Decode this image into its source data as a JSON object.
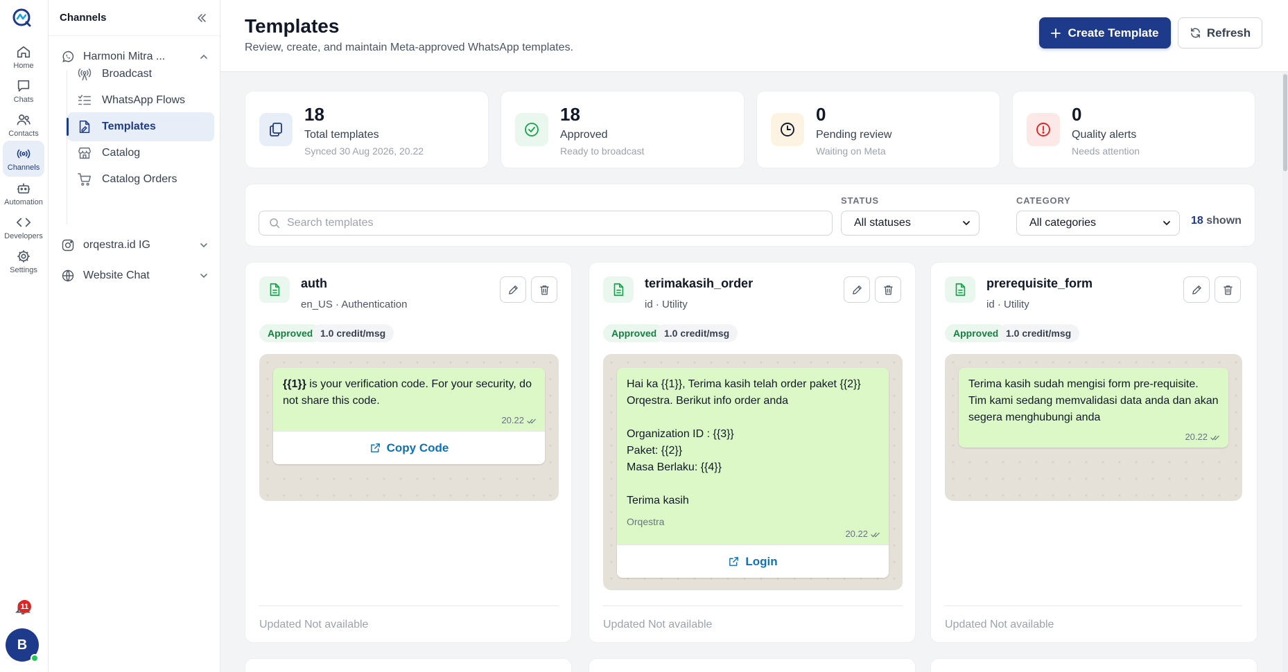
{
  "rail": {
    "items": [
      {
        "label": "Home",
        "icon": "home-icon"
      },
      {
        "label": "Chats",
        "icon": "chat-icon"
      },
      {
        "label": "Contacts",
        "icon": "contacts-icon"
      },
      {
        "label": "Channels",
        "icon": "broadcast-icon"
      },
      {
        "label": "Automation",
        "icon": "robot-icon"
      },
      {
        "label": "Developers",
        "icon": "code-icon"
      },
      {
        "label": "Settings",
        "icon": "gear-icon"
      }
    ],
    "notification_count": "11",
    "avatar_initial": "B"
  },
  "sidebar": {
    "title": "Channels",
    "groups": [
      {
        "label": "Harmoni Mitra ...",
        "icon": "whatsapp-icon"
      },
      {
        "label": "orqestra.id IG",
        "icon": "instagram-icon"
      },
      {
        "label": "Website Chat",
        "icon": "globe-icon"
      }
    ],
    "items": [
      {
        "label": "Broadcast",
        "icon": "broadcast-icon"
      },
      {
        "label": "WhatsApp Flows",
        "icon": "list-check-icon"
      },
      {
        "label": "Templates",
        "icon": "file-signature-icon"
      },
      {
        "label": "Catalog",
        "icon": "store-icon"
      },
      {
        "label": "Catalog Orders",
        "icon": "cart-icon"
      }
    ]
  },
  "header": {
    "title": "Templates",
    "subtitle": "Review, create, and maintain Meta-approved WhatsApp templates.",
    "create_label": "Create Template",
    "refresh_label": "Refresh"
  },
  "stats": [
    {
      "value": "18",
      "label": "Total templates",
      "hint": "Synced 30 Aug 2026, 20.22",
      "icon": "copy-icon",
      "color": "#1e3a8a"
    },
    {
      "value": "18",
      "label": "Approved",
      "hint": "Ready to broadcast",
      "icon": "check-circle-icon",
      "color": "#16a34a"
    },
    {
      "value": "0",
      "label": "Pending review",
      "hint": "Waiting on Meta",
      "icon": "clock-icon",
      "color": "#111827"
    },
    {
      "value": "0",
      "label": "Quality alerts",
      "hint": "Needs attention",
      "icon": "alert-circle-icon",
      "color": "#dc2626"
    }
  ],
  "filters": {
    "search_placeholder": "Search templates",
    "status_label": "STATUS",
    "status_value": "All statuses",
    "category_label": "CATEGORY",
    "category_value": "All categories",
    "shown_count": "18",
    "shown_suffix": "shown"
  },
  "templates": [
    {
      "name": "auth",
      "language": "en_US",
      "category": "Authentication",
      "status": "Approved",
      "credit": "1.0 credit/msg",
      "body_prefix": "{{1}}",
      "body": " is your verification code. For your security, do not share this code.",
      "footer": "",
      "time": "20.22",
      "button": "Copy Code",
      "updated": "Updated Not available"
    },
    {
      "name": "terimakasih_order",
      "language": "id",
      "category": "Utility",
      "status": "Approved",
      "credit": "1.0 credit/msg",
      "body": "Hai ka {{1}}, Terima kasih telah order paket {{2}} Orqestra. Berikut info order anda\n\nOrganization ID : {{3}}\nPaket: {{2}}\nMasa Berlaku: {{4}}\n\nTerima kasih",
      "footer": "Orqestra",
      "time": "20.22",
      "button": "Login",
      "updated": "Updated Not available"
    },
    {
      "name": "prerequisite_form",
      "language": "id",
      "category": "Utility",
      "status": "Approved",
      "credit": "1.0 credit/msg",
      "body": "Terima kasih sudah mengisi form pre-requisite. Tim kami sedang memvalidasi data anda dan akan segera menghubungi anda",
      "footer": "",
      "time": "20.22",
      "button": "",
      "updated": "Updated Not available"
    }
  ],
  "dot_separator": "·"
}
